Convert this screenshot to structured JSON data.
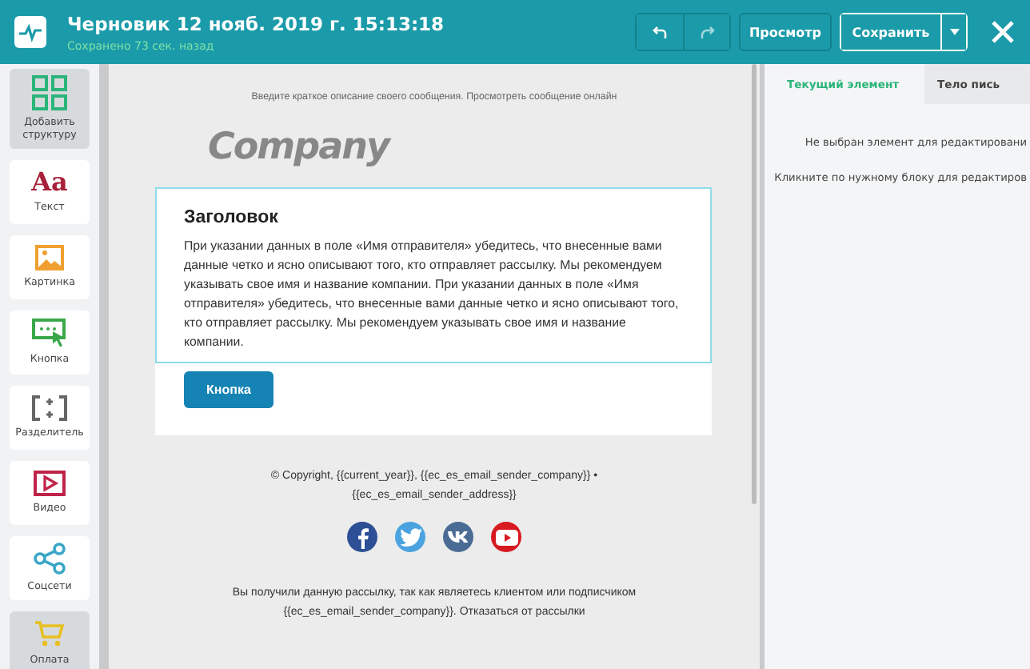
{
  "header": {
    "title": "Черновик 12 нояб. 2019 г. 15:13:18",
    "status": "Сохранено 73 сек. назад",
    "preview_button": "Просмотр",
    "save_button": "Сохранить"
  },
  "sidebar": {
    "items": [
      {
        "kind": "structure",
        "label": "Добавить структуру",
        "highlighted": true
      },
      {
        "kind": "text",
        "glyph": "Aa",
        "label": "Текст",
        "highlighted": false
      },
      {
        "kind": "image",
        "label": "Картинка",
        "highlighted": false
      },
      {
        "kind": "button",
        "label": "Кнопка",
        "highlighted": false
      },
      {
        "kind": "divider",
        "label": "Разделитель",
        "highlighted": false
      },
      {
        "kind": "video",
        "label": "Видео",
        "highlighted": false
      },
      {
        "kind": "social",
        "label": "Соцсети",
        "highlighted": false
      },
      {
        "kind": "payment",
        "label": "Оплата",
        "highlighted": true
      }
    ]
  },
  "email": {
    "preheader": "Введите краткое описание своего сообщения. Просмотреть сообщение онлайн",
    "logo": "Company",
    "heading": "Заголовок",
    "body": "При указании данных в поле «Имя отправителя» убедитесь, что внесенные вами данные четко и ясно описывают того, кто отправляет рассылку. Мы рекомендуем указывать свое имя и название компании. При указании данных в поле «Имя отправителя» убедитесь, что внесенные вами данные четко и ясно описывают того, кто отправляет рассылку. Мы рекомендуем указывать свое имя и название компании.",
    "button": "Кнопка",
    "footer_copyright": "© Copyright, {{current_year}}, {{ec_es_email_sender_company}} • {{ec_es_email_sender_address}}",
    "social": [
      {
        "kind": "facebook",
        "color": "#2d4f96"
      },
      {
        "kind": "twitter",
        "color": "#4aa3df"
      },
      {
        "kind": "vk",
        "color": "#4a6b93"
      },
      {
        "kind": "youtube",
        "color": "#d71921"
      }
    ],
    "footer_notice": "Вы получили данную рассылку, так как являетесь клиентом или подписчиком {{ec_es_email_sender_company}}. Отказаться от рассылки"
  },
  "panel": {
    "tabs": [
      {
        "label": "Текущий элемент",
        "selected": true
      },
      {
        "label": "Тело пись",
        "selected": false
      }
    ],
    "messages": [
      "Не выбран элемент для редактировани",
      "Кликните по нужному блоку для редактиров"
    ]
  }
}
